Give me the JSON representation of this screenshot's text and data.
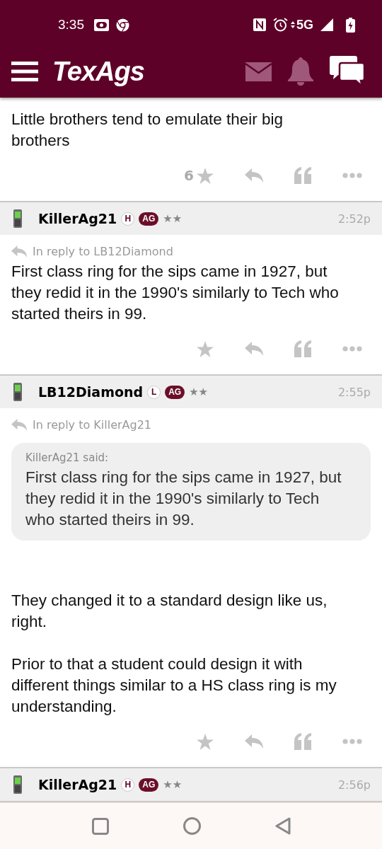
{
  "status_bar": {
    "time": "3:35",
    "network": "5G"
  },
  "app_bar": {
    "logo": "TexAgs"
  },
  "posts": [
    {
      "body": "Little brothers tend to emulate their big\nbrothers",
      "likes": "6"
    },
    {
      "header": {
        "username": "KillerAg21",
        "badges": [
          {
            "label": "H",
            "kind": "outline"
          },
          {
            "label": "AG",
            "kind": "filled"
          }
        ],
        "rank": "★★",
        "time": "2:52p"
      },
      "reply_to": "In reply to LB12Diamond",
      "body": "First class ring for the sips came in 1927, but\nthey redid it in the 1990's similarly to Tech who\nstarted theirs in 99."
    },
    {
      "header": {
        "username": "LB12Diamond",
        "badges": [
          {
            "label": "L",
            "kind": "outline"
          },
          {
            "label": "AG",
            "kind": "filled"
          }
        ],
        "rank": "★★",
        "time": "2:55p"
      },
      "reply_to": "In reply to KillerAg21",
      "quote": {
        "author": "KillerAg21 said:",
        "text": "First class ring for the sips came in 1927, but\nthey redid it in the 1990's similarly to Tech\nwho started theirs in 99."
      },
      "body": "They changed it to a standard design like us,\nright.\n\nPrior to that a student could design it with\ndifferent things similar to a HS class ring is my\nunderstanding."
    },
    {
      "header": {
        "username": "KillerAg21",
        "badges": [
          {
            "label": "H",
            "kind": "outline"
          },
          {
            "label": "AG",
            "kind": "filled"
          }
        ],
        "rank": "★★",
        "time": "2:56p"
      }
    }
  ]
}
